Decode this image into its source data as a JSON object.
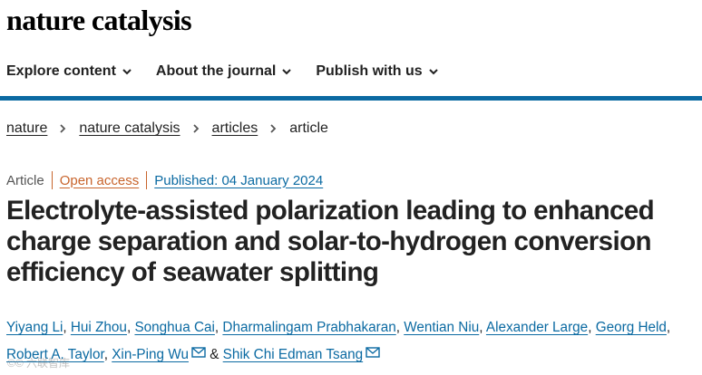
{
  "logo": "nature catalysis",
  "nav": [
    {
      "label": "Explore content"
    },
    {
      "label": "About the journal"
    },
    {
      "label": "Publish with us"
    }
  ],
  "breadcrumb": [
    "nature",
    "nature catalysis",
    "articles",
    "article"
  ],
  "meta": {
    "type": "Article",
    "access": "Open access",
    "published": "Published: 04 January 2024"
  },
  "article": {
    "title": "Electrolyte-assisted polarization leading to enhanced charge separation and solar-to-hydrogen conversion efficiency of seawater splitting"
  },
  "authors": [
    "Yiyang Li",
    "Hui Zhou",
    "Songhua Cai",
    "Dharmalingam Prabhakaran",
    "Wentian Niu",
    "Alexander Large",
    "Georg Held",
    "Robert A. Taylor",
    "Xin-Ping Wu",
    "Shik Chi Edman Tsang"
  ],
  "author_separators": {
    "comma": ",",
    "and": "&"
  },
  "watermark": "©© 六联智库",
  "colors": {
    "accent": "#0b6aa2",
    "open_access": "#c8642c",
    "text": "#222222"
  }
}
